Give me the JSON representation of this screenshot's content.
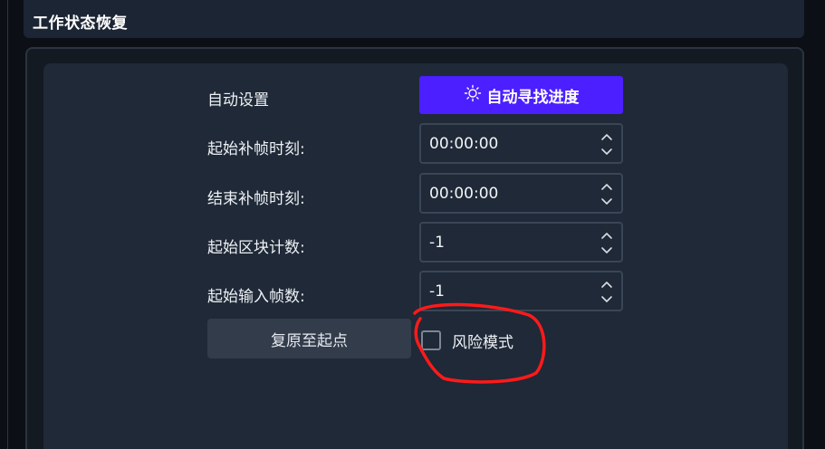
{
  "header": {
    "title": "工作状态恢复"
  },
  "auto": {
    "label": "自动设置",
    "button_label": "自动寻找进度",
    "button_icon": "lightbulb-icon"
  },
  "fields": [
    {
      "label": "起始补帧时刻:",
      "value": "00:00:00"
    },
    {
      "label": "结束补帧时刻:",
      "value": "00:00:00"
    },
    {
      "label": "起始区块计数:",
      "value": "-1"
    },
    {
      "label": "起始输入帧数:",
      "value": "-1"
    }
  ],
  "reset_button": {
    "label": "复原至起点"
  },
  "risk_mode": {
    "label": "风险模式",
    "checked": false
  },
  "colors": {
    "accent": "#4b1fff",
    "annotation": "#ff1a1a"
  }
}
